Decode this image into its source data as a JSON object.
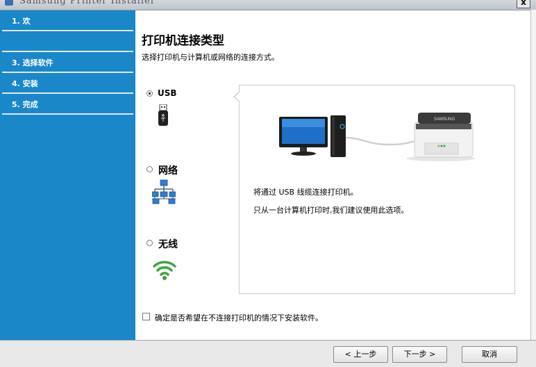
{
  "window": {
    "title": "Samsung Printer Installer",
    "close_label": "x"
  },
  "sidebar": {
    "steps": [
      {
        "label": "1. 欢"
      },
      {
        "label": ""
      },
      {
        "label": "3. 选择软件"
      },
      {
        "label": "4. 安装"
      },
      {
        "label": "5. 完成"
      }
    ]
  },
  "main": {
    "heading": "打印机连接类型",
    "subheading": "选择打印机与计算机或网络的连接方式。",
    "options": [
      {
        "label": "USB",
        "selected": true,
        "icon": "usb-plug-icon"
      },
      {
        "label": "网络",
        "selected": false,
        "icon": "network-icon"
      },
      {
        "label": "无线",
        "selected": false,
        "icon": "wifi-icon"
      }
    ],
    "panel": {
      "illustration": "computer-connected-to-printer-icon",
      "printer_brand": "SAMSUNG",
      "line1": "将通过 USB 线缆连接打印机。",
      "line2": "只从一台计算机打印时,我们建议使用此选项。"
    },
    "skip_checkbox": {
      "label": "确定是否希望在不连接打印机的情况下安装软件。",
      "checked": false
    }
  },
  "footer": {
    "back_label": "< 上一步",
    "next_label": "下一步 >",
    "cancel_label": "取消"
  },
  "colors": {
    "sidebar": "#1a87c9",
    "panel_border": "#c8cdd2",
    "wifi_green": "#3aa63a"
  }
}
